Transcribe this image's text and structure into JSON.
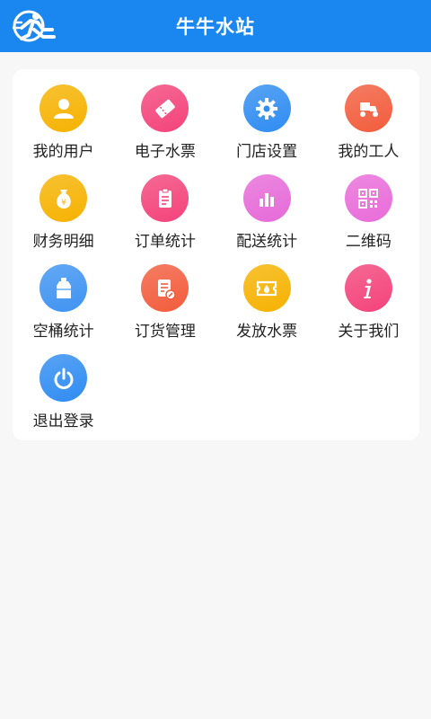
{
  "header": {
    "title": "牛牛水站"
  },
  "menu": {
    "items": [
      {
        "label": "我的用户",
        "icon": "user-icon",
        "color": "#f6b200"
      },
      {
        "label": "电子水票",
        "icon": "ticket-icon",
        "color": "#f3437a"
      },
      {
        "label": "门店设置",
        "icon": "gear-icon",
        "color": "#2f8cf2"
      },
      {
        "label": "我的工人",
        "icon": "delivery-bike-icon",
        "color": "#f25c3c"
      },
      {
        "label": "财务明细",
        "icon": "money-bag-icon",
        "color": "#f6b200"
      },
      {
        "label": "订单统计",
        "icon": "clipboard-icon",
        "color": "#f3437a"
      },
      {
        "label": "配送统计",
        "icon": "bar-chart-icon",
        "color": "#e66ad8"
      },
      {
        "label": "二维码",
        "icon": "qr-code-icon",
        "color": "#e96bd9"
      },
      {
        "label": "空桶统计",
        "icon": "water-bottle-icon",
        "color": "#3e93f2"
      },
      {
        "label": "订货管理",
        "icon": "order-edit-icon",
        "color": "#f25c3c"
      },
      {
        "label": "发放水票",
        "icon": "coupon-icon",
        "color": "#f6b200"
      },
      {
        "label": "关于我们",
        "icon": "info-icon",
        "color": "#f3437a"
      },
      {
        "label": "退出登录",
        "icon": "power-icon",
        "color": "#2f8cf2"
      }
    ]
  }
}
